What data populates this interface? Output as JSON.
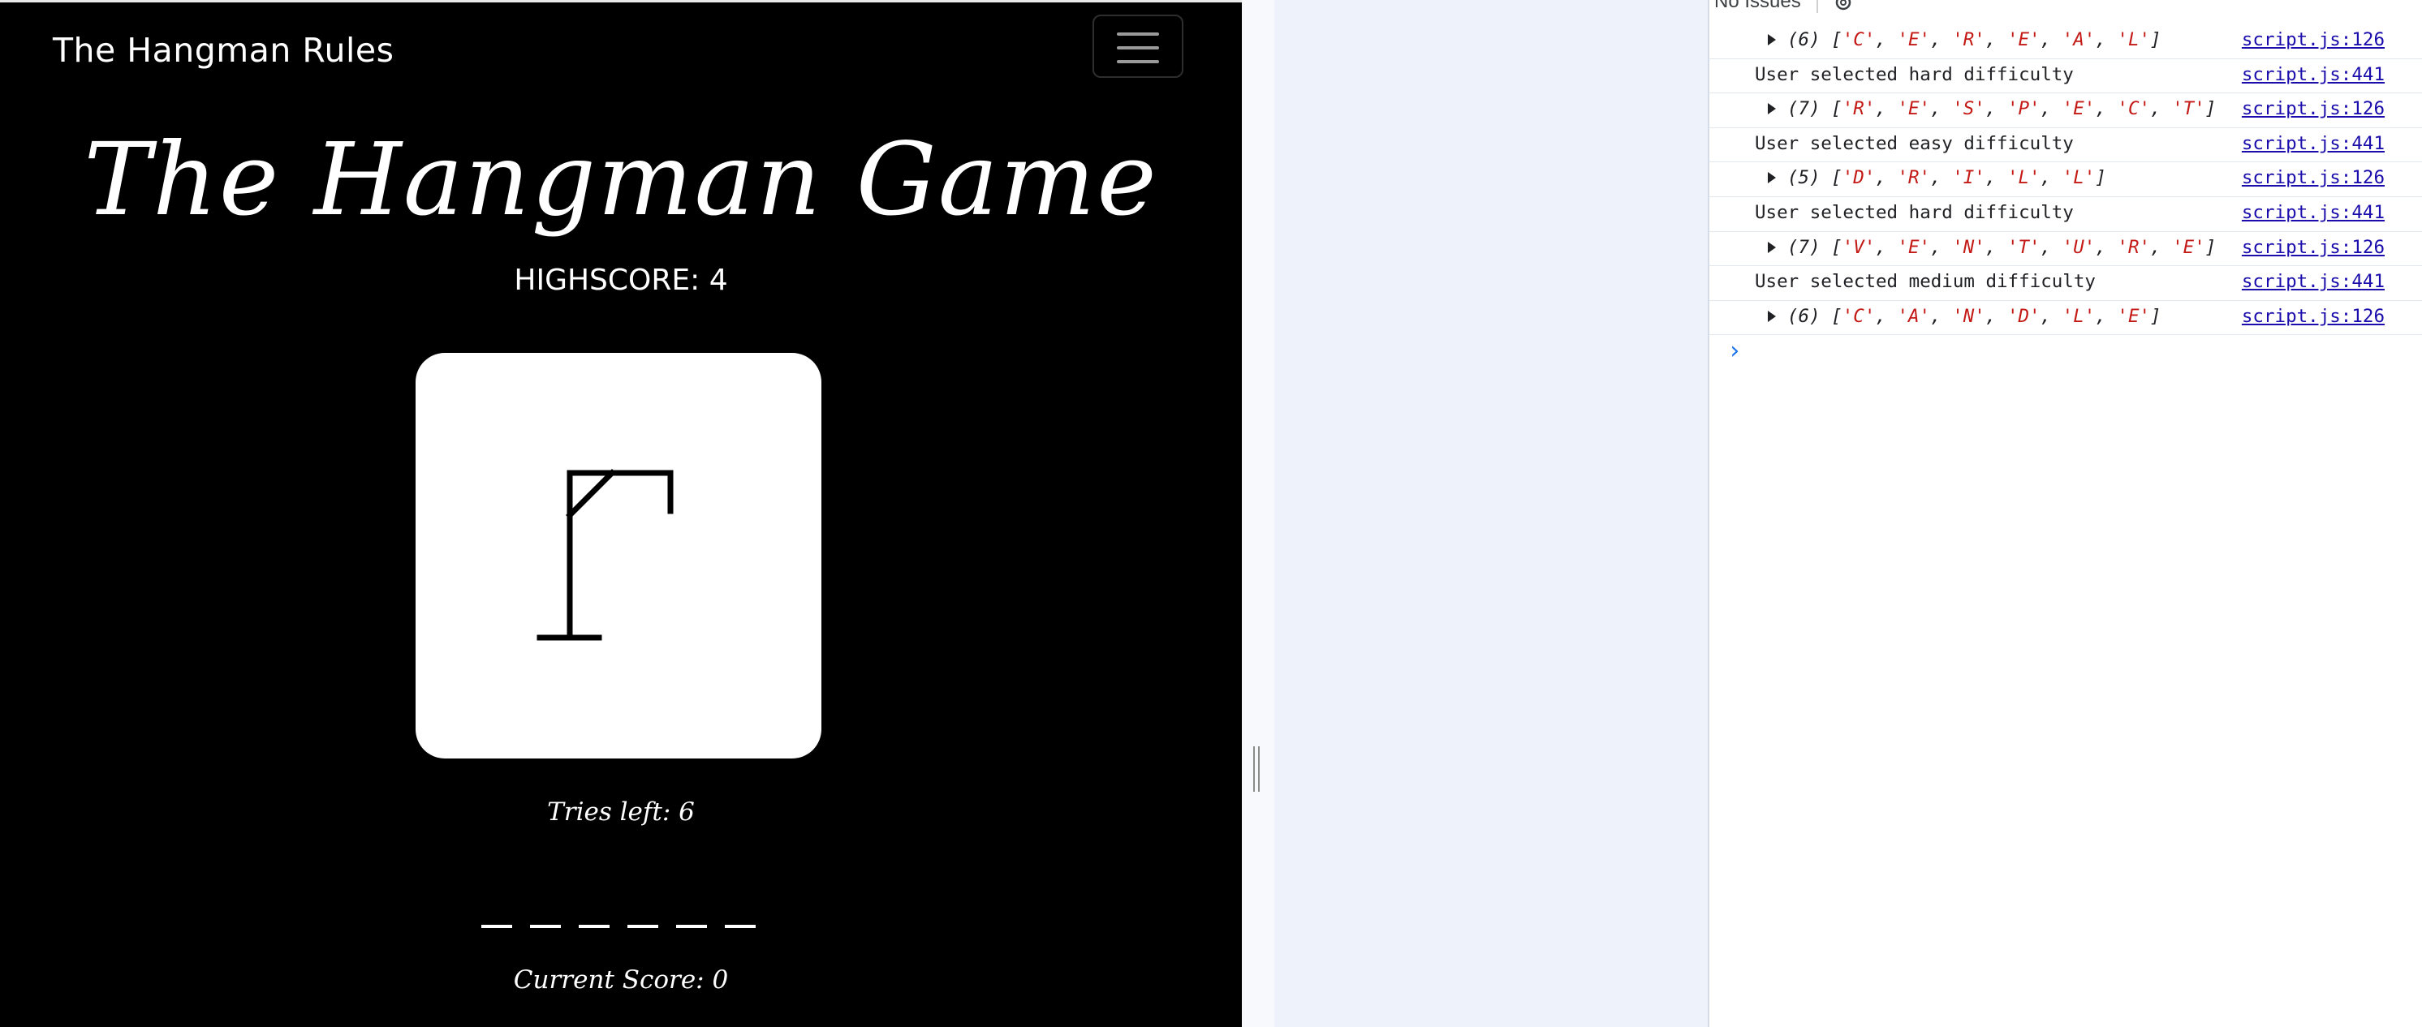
{
  "game": {
    "brand": "The Hangman Rules",
    "title": "The Hangman Game",
    "highscore": "HIGHSCORE: 4",
    "tries_left": "Tries left: 6",
    "current_score": "Current Score: 0",
    "word_length": 6,
    "colors": {
      "background": "#000000",
      "board": "#ffffff",
      "text": "#ffffff"
    }
  },
  "devtools": {
    "issues": "No Issues",
    "prompt": "›",
    "console": [
      {
        "type": "array",
        "count": "(6)",
        "items": [
          "C",
          "E",
          "R",
          "E",
          "A",
          "L"
        ],
        "source": "script.js:126"
      },
      {
        "type": "log",
        "text": "User selected hard difficulty",
        "source": "script.js:441"
      },
      {
        "type": "array",
        "count": "(7)",
        "items": [
          "R",
          "E",
          "S",
          "P",
          "E",
          "C",
          "T"
        ],
        "source": "script.js:126"
      },
      {
        "type": "log",
        "text": "User selected easy difficulty",
        "source": "script.js:441"
      },
      {
        "type": "array",
        "count": "(5)",
        "items": [
          "D",
          "R",
          "I",
          "L",
          "L"
        ],
        "source": "script.js:126"
      },
      {
        "type": "log",
        "text": "User selected hard difficulty",
        "source": "script.js:441"
      },
      {
        "type": "array",
        "count": "(7)",
        "items": [
          "V",
          "E",
          "N",
          "T",
          "U",
          "R",
          "E"
        ],
        "source": "script.js:126"
      },
      {
        "type": "log",
        "text": "User selected medium difficulty",
        "source": "script.js:441"
      },
      {
        "type": "array",
        "count": "(6)",
        "items": [
          "C",
          "A",
          "N",
          "D",
          "L",
          "E"
        ],
        "source": "script.js:126"
      }
    ]
  }
}
